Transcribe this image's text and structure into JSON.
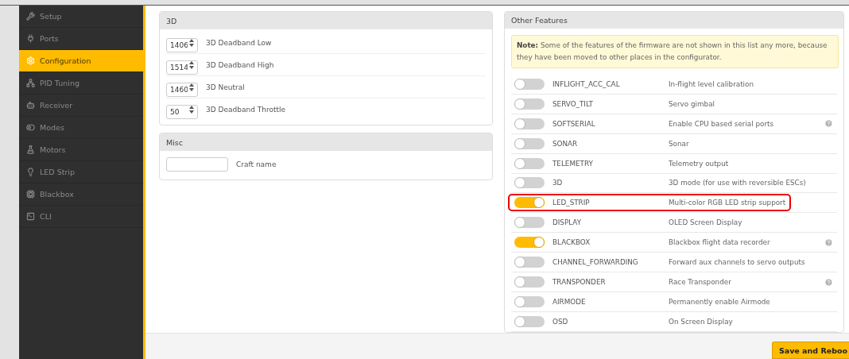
{
  "sidebar": {
    "items": [
      {
        "label": "Setup",
        "selected": false
      },
      {
        "label": "Ports",
        "selected": false
      },
      {
        "label": "Configuration",
        "selected": true
      },
      {
        "label": "PID Tuning",
        "selected": false
      },
      {
        "label": "Receiver",
        "selected": false
      },
      {
        "label": "Modes",
        "selected": false
      },
      {
        "label": "Motors",
        "selected": false
      },
      {
        "label": "LED Strip",
        "selected": false
      },
      {
        "label": "Blackbox",
        "selected": false
      },
      {
        "label": "CLI",
        "selected": false
      }
    ]
  },
  "panels": [
    {
      "title": "3D",
      "fields": [
        {
          "kind": "number",
          "value": "1406",
          "label": "3D Deadband Low"
        },
        {
          "kind": "number",
          "value": "1514",
          "label": "3D Deadband High"
        },
        {
          "kind": "number",
          "value": "1460",
          "label": "3D Neutral"
        },
        {
          "kind": "number",
          "value": "50",
          "label": "3D Deadband Throttle"
        }
      ]
    },
    {
      "title": "Misc",
      "fields": [
        {
          "kind": "text",
          "label": "Craft name"
        }
      ]
    }
  ],
  "features": {
    "title": "Other Features",
    "note": "**Note:** Some of the features of the firmware are not shown in this list any more, because they have been moved to other places in the configurator.",
    "rows": [
      {
        "name": "INFLIGHT_ACC_CAL",
        "description": "In-flight level calibration",
        "on": false,
        "help": false,
        "highlighted": false
      },
      {
        "name": "SERVO_TILT",
        "description": "Servo gimbal",
        "on": false,
        "help": false,
        "highlighted": false
      },
      {
        "name": "SOFTSERIAL",
        "description": "Enable CPU based serial ports",
        "on": false,
        "help": true,
        "highlighted": false
      },
      {
        "name": "SONAR",
        "description": "Sonar",
        "on": false,
        "help": false,
        "highlighted": false
      },
      {
        "name": "TELEMETRY",
        "description": "Telemetry output",
        "on": false,
        "help": false,
        "highlighted": false
      },
      {
        "name": "3D",
        "description": "3D mode (for use with reversible ESCs)",
        "on": false,
        "help": false,
        "highlighted": false
      },
      {
        "name": "LED_STRIP",
        "description": "Multi-color RGB LED strip support",
        "on": true,
        "help": false,
        "highlighted": true
      },
      {
        "name": "DISPLAY",
        "description": "OLED Screen Display",
        "on": false,
        "help": false,
        "highlighted": false
      },
      {
        "name": "BLACKBOX",
        "description": "Blackbox flight data recorder",
        "on": true,
        "help": true,
        "highlighted": false
      },
      {
        "name": "CHANNEL_FORWARDING",
        "description": "Forward aux channels to servo outputs",
        "on": false,
        "help": false,
        "highlighted": false
      },
      {
        "name": "TRANSPONDER",
        "description": "Race Transponder",
        "on": false,
        "help": true,
        "highlighted": false
      },
      {
        "name": "AIRMODE",
        "description": "Permanently enable Airmode",
        "on": false,
        "help": false,
        "highlighted": false
      },
      {
        "name": "OSD",
        "description": "On Screen Display",
        "on": false,
        "help": false,
        "highlighted": false
      }
    ]
  },
  "footer": {
    "button": "Save and Reboo"
  }
}
